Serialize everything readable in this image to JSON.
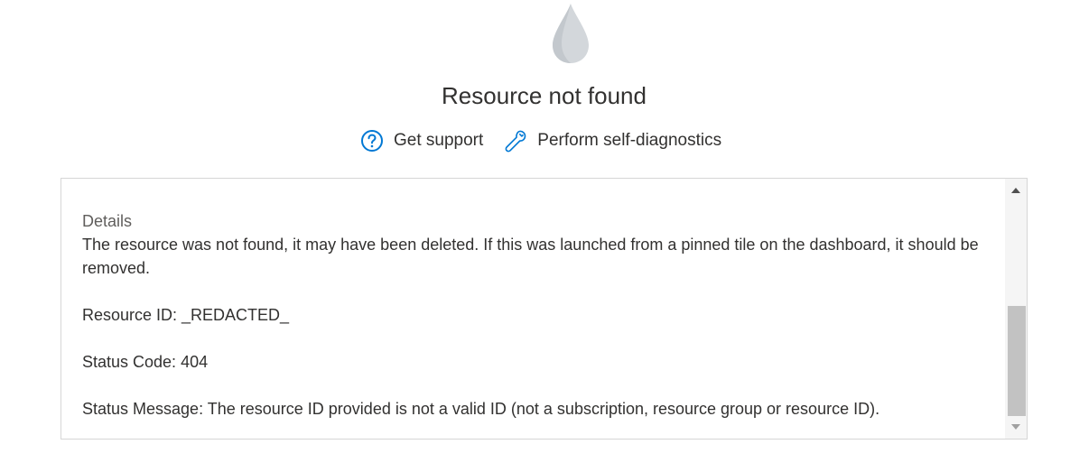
{
  "header": {
    "icon": "water-drop-icon",
    "title": "Resource not found"
  },
  "actions": {
    "support_icon": "help-circle-icon",
    "support_label": "Get support",
    "diagnostics_icon": "wrench-icon",
    "diagnostics_label": "Perform self-diagnostics"
  },
  "details": {
    "heading": "Details",
    "message": "The resource was not found, it may have been deleted. If this was launched from a pinned tile on the dashboard, it should be removed.",
    "resource_id": "Resource ID: _REDACTED_",
    "status_code": "Status Code: 404",
    "status_message": "Status Message: The resource ID provided is not a valid ID (not a subscription, resource group or resource ID)."
  },
  "colors": {
    "accent": "#0078d4",
    "drop": "#d0d4d8",
    "text": "#323130",
    "muted": "#605e5c"
  }
}
